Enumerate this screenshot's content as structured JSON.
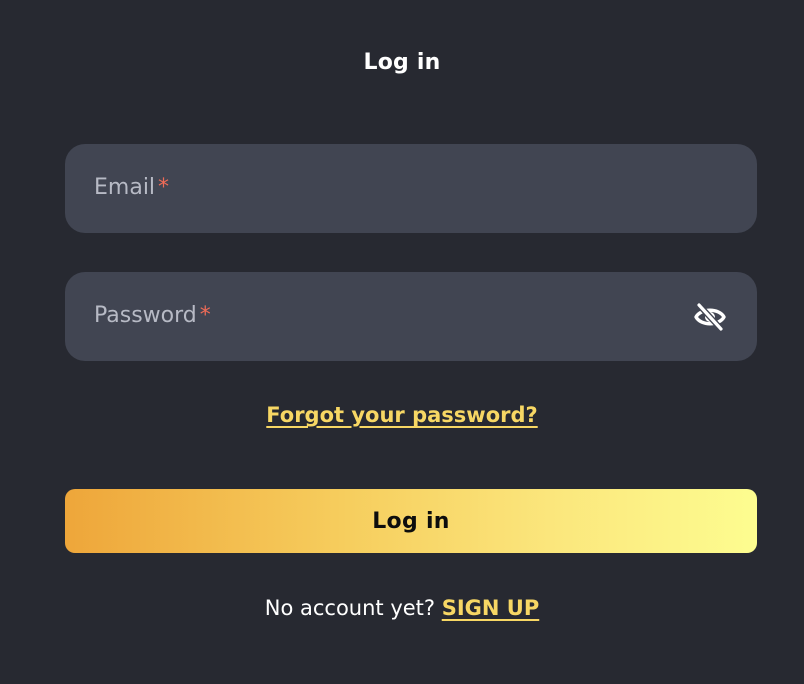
{
  "header": {
    "title": "Log in"
  },
  "form": {
    "email": {
      "label": "Email",
      "required_mark": "*",
      "value": ""
    },
    "password": {
      "label": "Password",
      "required_mark": "*",
      "value": "",
      "toggle_icon": "eye-off-icon"
    },
    "forgot_link": "Forgot your password?",
    "submit_label": "Log in"
  },
  "footer": {
    "prompt": "No account yet?",
    "signup_link": "SIGN UP"
  },
  "colors": {
    "background": "#272931",
    "field_background": "#414552",
    "accent": "#f7d764",
    "required": "#ef6b57",
    "button_gradient_start": "#eea63a",
    "button_gradient_end": "#fdfd90"
  }
}
